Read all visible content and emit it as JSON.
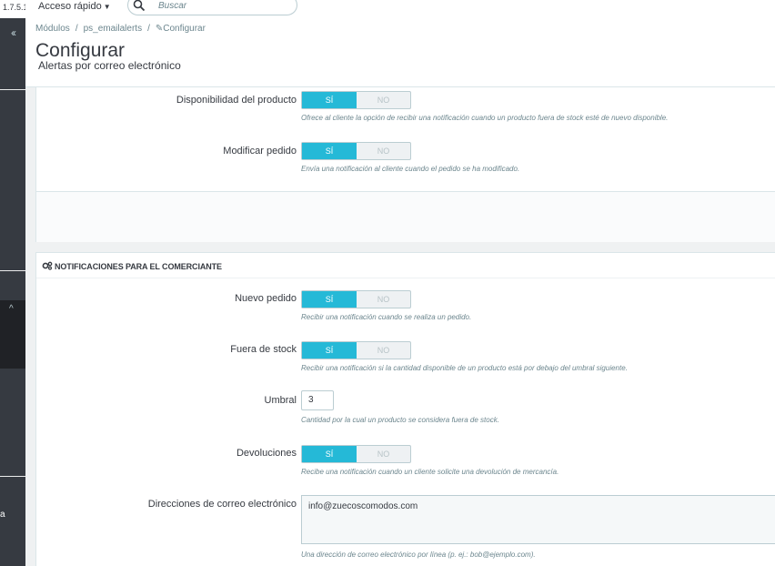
{
  "app": {
    "version": "1.7.5.1",
    "quick_access": "Acceso rápido",
    "search_placeholder": "Buscar"
  },
  "sidebar": {
    "collapse_glyph": "‹‹",
    "cut_label": "a"
  },
  "breadcrumb": [
    "Módulos",
    "ps_emailalerts",
    "Configurar"
  ],
  "header": {
    "title": "Configurar",
    "subtitle": "Alertas por correo electrónico"
  },
  "customer_panel": {
    "rows": [
      {
        "label": "Disponibilidad del producto",
        "value": "SÍ",
        "on": "SÍ",
        "off": "NO",
        "help": "Ofrece al cliente la opción de recibir una notificación cuando un producto fuera de stock esté de nuevo disponible."
      },
      {
        "label": "Modificar pedido",
        "value": "SÍ",
        "on": "SÍ",
        "off": "NO",
        "help": "Envía una notificación al cliente cuando el pedido se ha modificado."
      }
    ]
  },
  "merchant_panel": {
    "title": "NOTIFICACIONES PARA EL COMERCIANTE",
    "new_order": {
      "label": "Nuevo pedido",
      "value": "SÍ",
      "on": "SÍ",
      "off": "NO",
      "help": "Recibir una notificación cuando se realiza un pedido."
    },
    "out_of_stock": {
      "label": "Fuera de stock",
      "value": "SÍ",
      "on": "SÍ",
      "off": "NO",
      "help": "Recibir una notificación si la cantidad disponible de un producto está por debajo del umbral siguiente."
    },
    "threshold": {
      "label": "Umbral",
      "value": "3",
      "help": "Cantidad por la cual un producto se considera fuera de stock."
    },
    "returns": {
      "label": "Devoluciones",
      "value": "SÍ",
      "on": "SÍ",
      "off": "NO",
      "help": "Recibe una notificación cuando un cliente solicite una devolución de mercancía."
    },
    "emails": {
      "label": "Direcciones de correo electrónico",
      "value": "info@zuecoscomodos.com",
      "help": "Una dirección de correo electrónico por línea (p. ej.: bob@ejemplo.com)."
    }
  },
  "colors": {
    "accent": "#25b9d7",
    "sidebar": "#363a41",
    "background": "#eff1f2"
  }
}
